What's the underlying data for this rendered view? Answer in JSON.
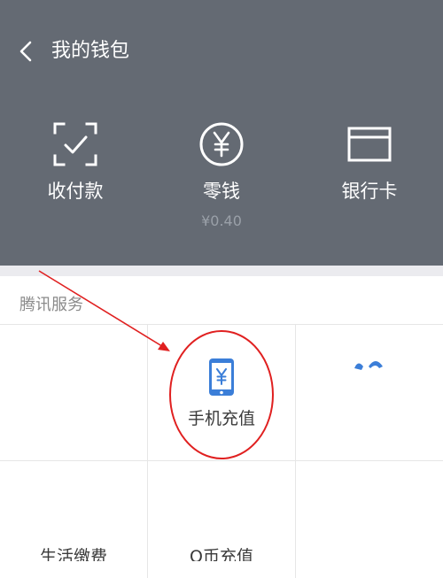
{
  "header": {
    "title": "我的钱包",
    "back_icon": "chevron-left-icon",
    "background_color": "#646a73"
  },
  "wallet": {
    "items": [
      {
        "label": "收付款",
        "icon": "scan-check-icon"
      },
      {
        "label": "零钱",
        "icon": "yen-circle-icon",
        "amount": "¥0.40"
      },
      {
        "label": "银行卡",
        "icon": "bank-card-icon"
      }
    ]
  },
  "services": {
    "section_title": "腾讯服务",
    "items": [
      {
        "label": "手机充值",
        "icon": "mobile-yen-icon"
      },
      {
        "label": "生活缴费"
      },
      {
        "label": "Q币充值"
      }
    ]
  },
  "annotation": {
    "color": "#e02020"
  }
}
